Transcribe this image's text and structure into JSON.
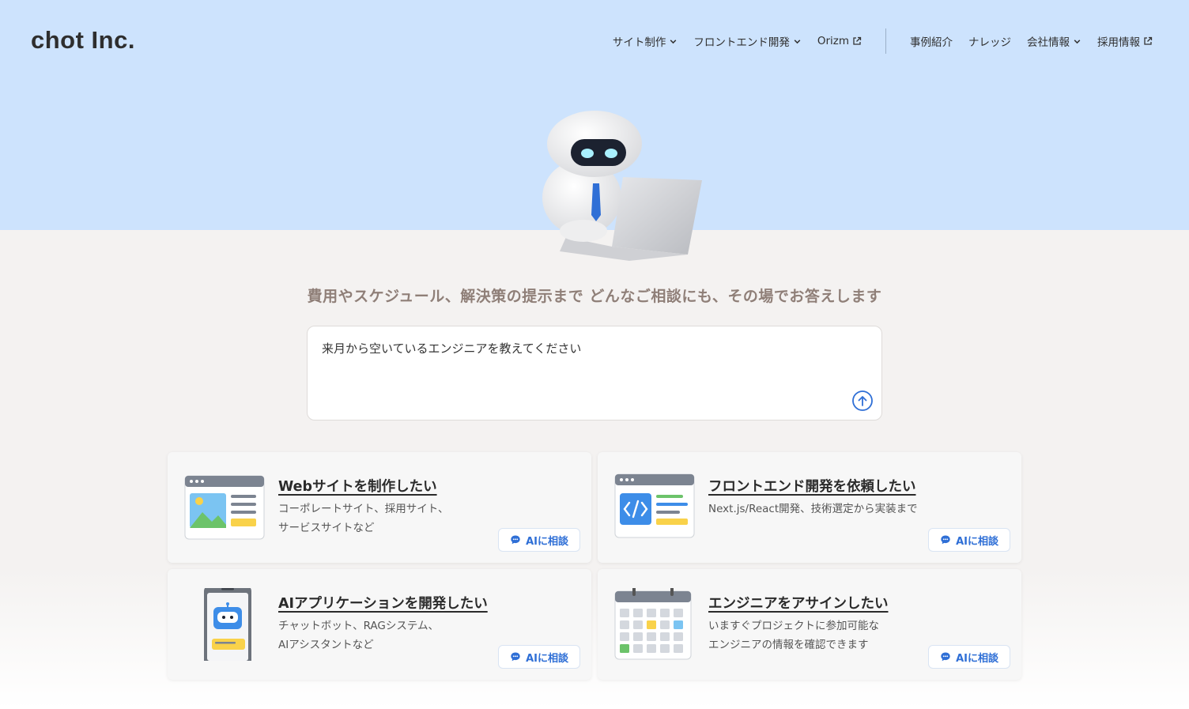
{
  "header": {
    "logo": "chot Inc.",
    "nav": [
      {
        "label": "サイト制作",
        "icon": "chevron-down-icon"
      },
      {
        "label": "フロントエンド開発",
        "icon": "chevron-down-icon"
      },
      {
        "label": "Orizm",
        "icon": "external-link-icon"
      },
      {
        "label": "事例紹介",
        "icon": ""
      },
      {
        "label": "ナレッジ",
        "icon": ""
      },
      {
        "label": "会社情報",
        "icon": "chevron-down-icon"
      },
      {
        "label": "採用情報",
        "icon": "external-link-icon"
      }
    ]
  },
  "hero": {
    "tagline": "費用やスケジュール、解決策の提示まで どんなご相談にも、その場でお答えします",
    "chat_value": "来月から空いているエンジニアを教えてください"
  },
  "cards": [
    {
      "title": "Webサイトを制作したい",
      "desc_line1": "コーポレートサイト、採用サイト、",
      "desc_line2": "サービスサイトなど",
      "button": "AIに相談"
    },
    {
      "title": "フロントエンド開発を依頼したい",
      "desc_line1": "Next.js/React開発、技術選定から実装まで",
      "desc_line2": "",
      "button": "AIに相談"
    },
    {
      "title": "AIアプリケーションを開発したい",
      "desc_line1": "チャットボット、RAGシステム、",
      "desc_line2": "AIアシスタントなど",
      "button": "AIに相談"
    },
    {
      "title": "エンジニアをアサインしたい",
      "desc_line1": "いますぐプロジェクトに参加可能な",
      "desc_line2": "エンジニアの情報を確認できます",
      "button": "AIに相談"
    }
  ],
  "colors": {
    "hero_bg": "#cde3fd",
    "page_bg": "#f4f2f1",
    "accent": "#2f6fd6",
    "tagline": "#8f7f78"
  }
}
